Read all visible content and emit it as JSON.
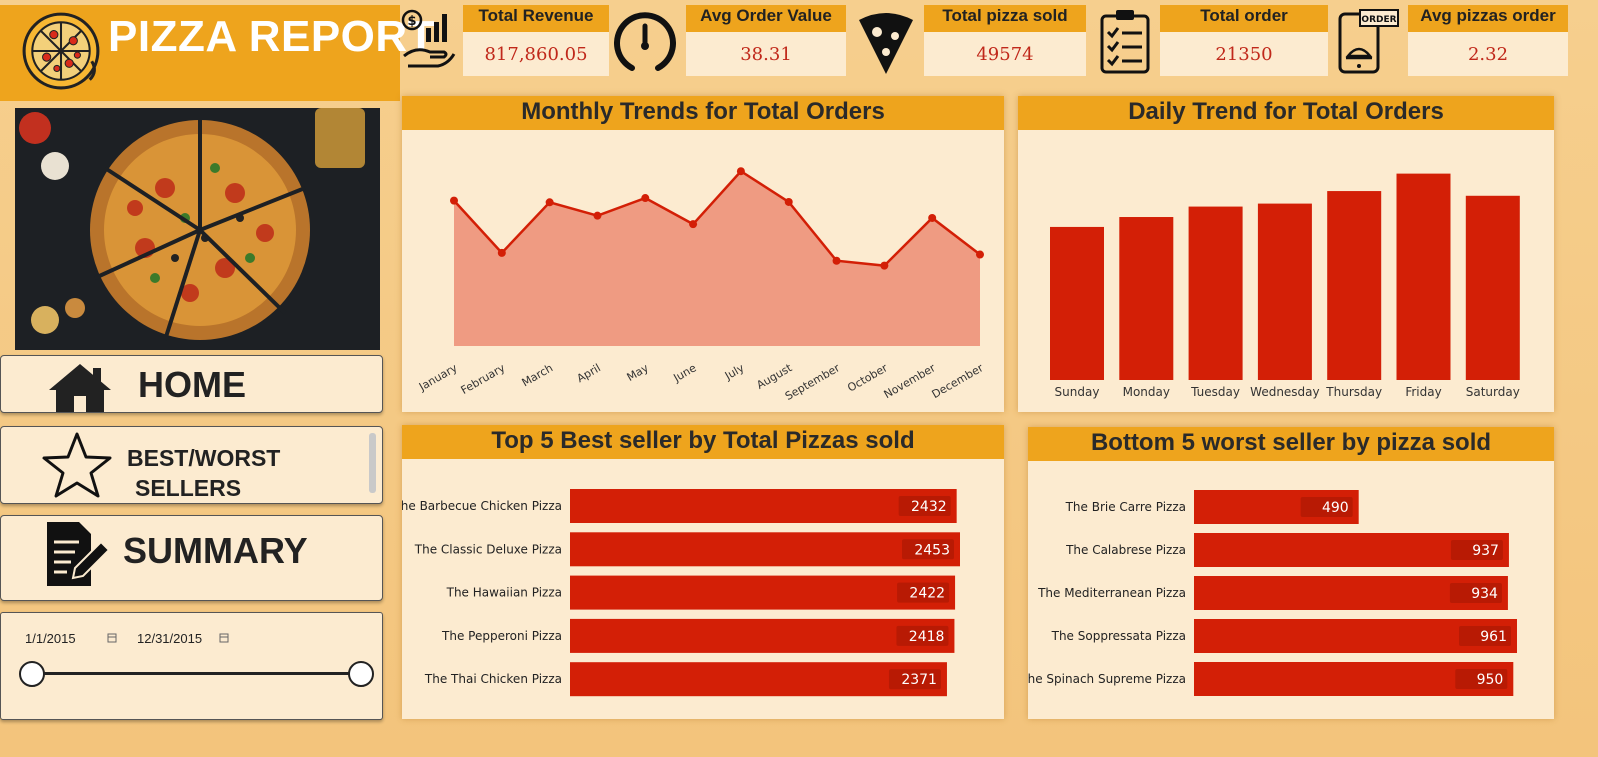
{
  "header": {
    "title": "PIZZA REPORT",
    "logo_icon": "pizza-icon"
  },
  "kpis": [
    {
      "label": "Total Revenue",
      "value": "817,860.05",
      "icon": "money-hand-chart-icon"
    },
    {
      "label": "Avg Order Value",
      "value": "38.31",
      "icon": "gauge-icon"
    },
    {
      "label": "Total pizza sold",
      "value": "49574",
      "icon": "pizza-slice-icon"
    },
    {
      "label": "Total order",
      "value": "21350",
      "icon": "clipboard-checklist-icon"
    },
    {
      "label": "Avg pizzas order",
      "value": "2.32",
      "icon": "phone-order-icon"
    }
  ],
  "nav": {
    "home": "HOME",
    "best_worst_line1": "BEST/WORST",
    "best_worst_line2": "SELLERS",
    "summary": "SUMMARY"
  },
  "date_slicer": {
    "start": "1/1/2015",
    "end": "12/31/2015"
  },
  "colors": {
    "accent": "#eea41d",
    "panel": "#fcebd0",
    "bar": "#d31f06",
    "area": "#ef9b82"
  },
  "chart_data": [
    {
      "type": "area",
      "title": "Monthly Trends for Total Orders",
      "categories": [
        "January",
        "February",
        "March",
        "April",
        "May",
        "June",
        "July",
        "August",
        "September",
        "October",
        "November",
        "December"
      ],
      "values": [
        1845,
        1685,
        1840,
        1799,
        1853,
        1773,
        1935,
        1841,
        1661,
        1646,
        1792,
        1680
      ],
      "ylim": [
        1400,
        2000
      ]
    },
    {
      "type": "bar",
      "title": "Daily Trend for Total Orders",
      "categories": [
        "Sunday",
        "Monday",
        "Tuesday",
        "Wednesday",
        "Thursday",
        "Friday",
        "Saturday"
      ],
      "values": [
        2624,
        2794,
        2973,
        3024,
        3239,
        3538,
        3158
      ],
      "ylim": [
        0,
        3600
      ]
    },
    {
      "type": "bar",
      "orientation": "horizontal",
      "title": "Top 5 Best seller by Total Pizzas sold",
      "categories": [
        "The Barbecue Chicken Pizza",
        "The Classic Deluxe Pizza",
        "The Hawaiian Pizza",
        "The Pepperoni Pizza",
        "The Thai Chicken Pizza"
      ],
      "values": [
        2432,
        2453,
        2422,
        2418,
        2371
      ],
      "labels": [
        "2432",
        "2453",
        "2422",
        "2418",
        "2371"
      ],
      "xlim": [
        0,
        2453
      ]
    },
    {
      "type": "bar",
      "orientation": "horizontal",
      "title": "Bottom 5 worst seller by pizza sold",
      "categories": [
        "The Brie Carre Pizza",
        "The Calabrese Pizza",
        "The Mediterranean Pizza",
        "The Soppressata Pizza",
        "The Spinach Supreme Pizza"
      ],
      "values": [
        490,
        937,
        934,
        961,
        950
      ],
      "labels": [
        "490",
        "937",
        "934",
        "961",
        "950"
      ],
      "xlim": [
        0,
        961
      ]
    }
  ]
}
